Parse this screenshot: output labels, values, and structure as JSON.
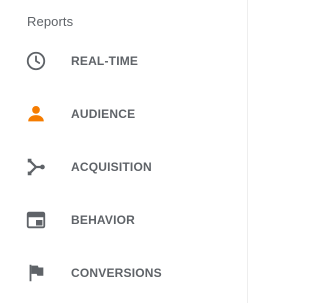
{
  "sidebar": {
    "section_title": "Reports",
    "items": [
      {
        "label": "REAL-TIME",
        "icon": "clock-icon",
        "color": "#5f6368"
      },
      {
        "label": "AUDIENCE",
        "icon": "person-icon",
        "color": "#f57c00"
      },
      {
        "label": "ACQUISITION",
        "icon": "acquisition-icon",
        "color": "#5f6368"
      },
      {
        "label": "BEHAVIOR",
        "icon": "behavior-icon",
        "color": "#5f6368"
      },
      {
        "label": "CONVERSIONS",
        "icon": "flag-icon",
        "color": "#5f6368"
      }
    ]
  }
}
